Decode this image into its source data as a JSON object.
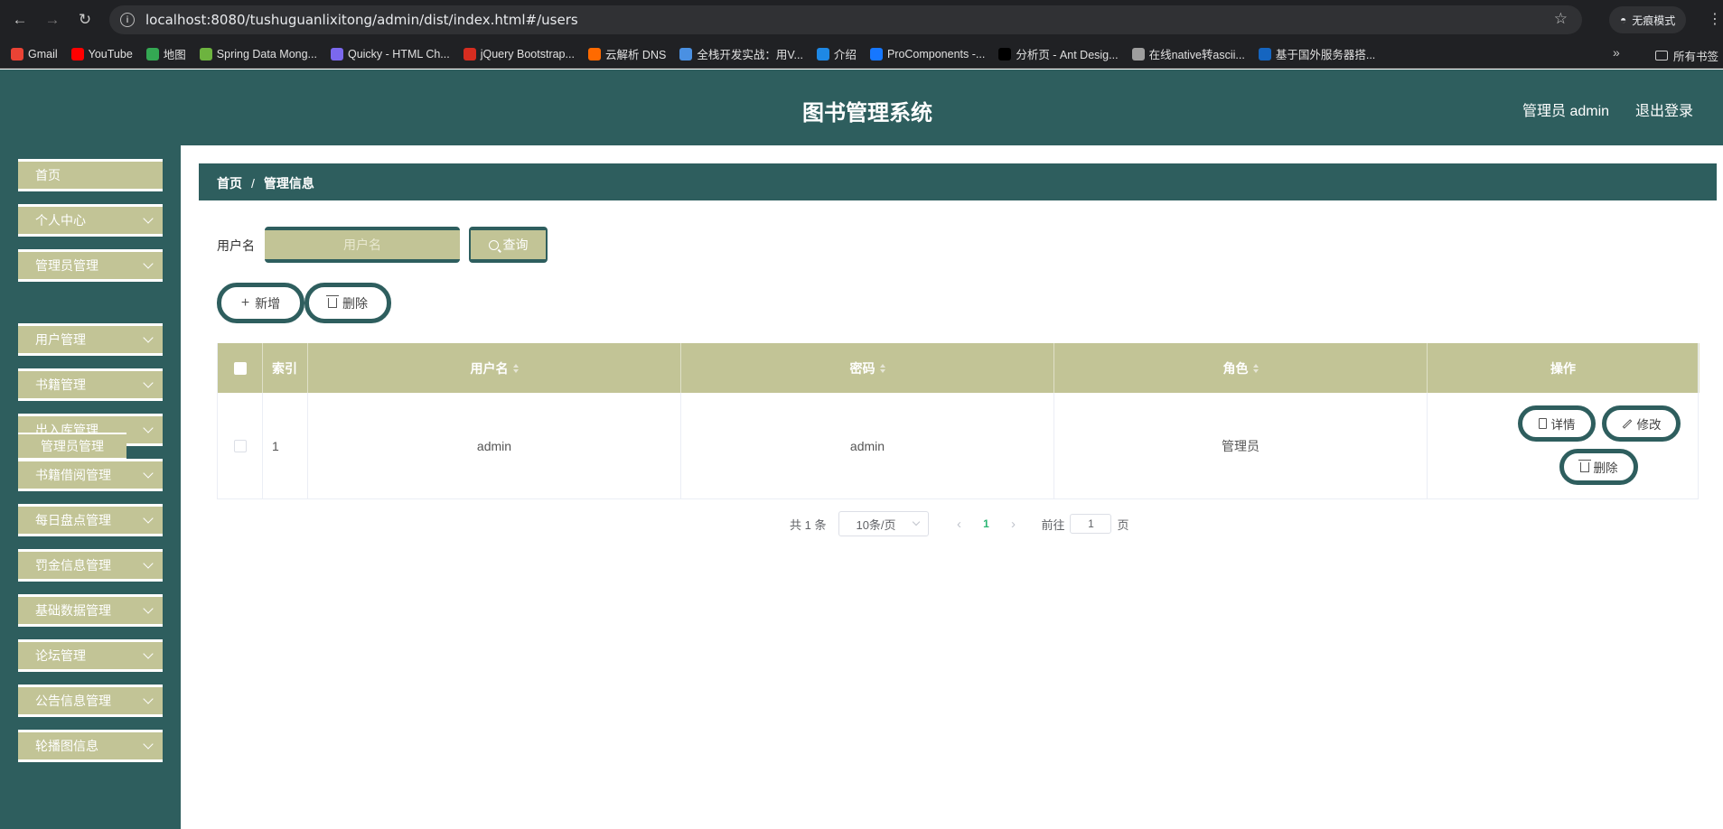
{
  "browser": {
    "url": "localhost:8080/tushuguanlixitong/admin/dist/index.html#/users",
    "incognito_label": "无痕模式",
    "bookmarks": [
      {
        "label": "Gmail",
        "color": "#ea4335"
      },
      {
        "label": "YouTube",
        "color": "#ff0000"
      },
      {
        "label": "地图",
        "color": "#34a853"
      },
      {
        "label": "Spring Data Mong...",
        "color": "#6db33f"
      },
      {
        "label": "Quicky - HTML Ch...",
        "color": "#7b68ee"
      },
      {
        "label": "jQuery Bootstrap...",
        "color": "#d62d20"
      },
      {
        "label": "云解析 DNS",
        "color": "#ff6a00"
      },
      {
        "label": "全栈开发实战：用V...",
        "color": "#4a90e2"
      },
      {
        "label": "介绍",
        "color": "#1e88e5"
      },
      {
        "label": "ProComponents -...",
        "color": "#1677ff"
      },
      {
        "label": "分析页 - Ant Desig...",
        "color": "#000000"
      },
      {
        "label": "在线native转ascii...",
        "color": "#9e9e9e"
      },
      {
        "label": "基于国外服务器搭...",
        "color": "#1565c0"
      }
    ],
    "all_bookmarks_label": "所有书签"
  },
  "header": {
    "title": "图书管理系统",
    "admin_label": "管理员 admin",
    "logout_label": "退出登录"
  },
  "sidebar": {
    "items": [
      {
        "label": "首页",
        "has_arrow": false
      },
      {
        "label": "个人中心",
        "has_arrow": true
      },
      {
        "label": "管理员管理",
        "has_arrow": true
      },
      {
        "label": "用户管理",
        "has_arrow": true
      },
      {
        "label": "书籍管理",
        "has_arrow": true
      },
      {
        "label": "出入库管理",
        "has_arrow": true
      },
      {
        "label": "书籍借阅管理",
        "has_arrow": true
      },
      {
        "label": "每日盘点管理",
        "has_arrow": true
      },
      {
        "label": "罚金信息管理",
        "has_arrow": true
      },
      {
        "label": "基础数据管理",
        "has_arrow": true
      },
      {
        "label": "论坛管理",
        "has_arrow": true
      },
      {
        "label": "公告信息管理",
        "has_arrow": true
      },
      {
        "label": "轮播图信息",
        "has_arrow": true
      }
    ],
    "submenu_label": "管理员管理"
  },
  "breadcrumb": {
    "home": "首页",
    "separator": "/",
    "current": "管理信息"
  },
  "search": {
    "label": "用户名",
    "placeholder": "用户名",
    "query_label": "查询"
  },
  "actions": {
    "add_label": "新增",
    "delete_label": "删除"
  },
  "table": {
    "columns": [
      "索引",
      "用户名",
      "密码",
      "角色",
      "操作"
    ],
    "rows": [
      {
        "index": "1",
        "username": "admin",
        "password": "admin",
        "role": "管理员"
      }
    ],
    "row_actions": {
      "detail": "详情",
      "edit": "修改",
      "delete": "删除"
    }
  },
  "pagination": {
    "total_label": "共 1 条",
    "page_size_label": "10条/页",
    "current_page": "1",
    "goto_prefix": "前往",
    "goto_value": "1",
    "goto_suffix": "页"
  },
  "colors": {
    "primary": "#2e5e5e",
    "accent": "#c2c496"
  }
}
